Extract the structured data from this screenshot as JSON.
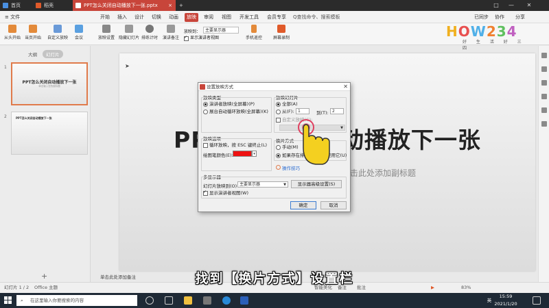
{
  "tabs": [
    {
      "label": "首页",
      "icon": "home-icon",
      "color": "#4a90e2"
    },
    {
      "label": "稻壳",
      "icon": "docer-icon",
      "color": "#e05a2a"
    },
    {
      "label": "PPT怎么关闭自动播放下一张.pptx",
      "icon": "pptx-file-icon",
      "color": "#e06a3a",
      "active": true
    }
  ],
  "window_controls": [
    "□",
    "—",
    "✕"
  ],
  "menu": {
    "file_label": "≡ 文件",
    "items": [
      "开始",
      "插入",
      "设计",
      "切换",
      "动画",
      "放映",
      "审阅",
      "视图",
      "开发工具",
      "会员专享"
    ],
    "active_item": "放映",
    "search_label": "Q查找命令、搜索模板",
    "right": [
      "已同步",
      "协作",
      "分享"
    ]
  },
  "ribbon": {
    "buttons": [
      "从头开始",
      "当页开始",
      "自定义放映",
      "会议",
      "放映设置",
      "隐藏幻灯片",
      "排练计时",
      "演讲备注",
      "手机遥控",
      "屏幕录制"
    ],
    "display_label": "放映到：",
    "display_value": "主要显示器",
    "presenter_view": "显示演讲者视图"
  },
  "logo": {
    "text": "HOW234",
    "slogan": "好 生 活 好 三 四"
  },
  "left_panel": {
    "tabs": [
      "大纲",
      "幻灯片"
    ],
    "active_tab": "幻灯片",
    "thumbnails": [
      {
        "num": "1",
        "title": "PPT怎么关闭自动播放下一张",
        "sub": "单击输入您的副标题"
      },
      {
        "num": "2",
        "title": "PPT怎么关闭自动播放下一张"
      }
    ]
  },
  "slide": {
    "title": "PPT怎么关闭自动播放下一张",
    "subtitle": "单击此处添加副标题"
  },
  "notes_placeholder": "单击此处添加备注",
  "status": {
    "slide_pos": "幻灯片 1 / 2",
    "theme": "Office 主题",
    "beautify": "智能美化",
    "notes": "备注",
    "comment": "批注",
    "zoom": "83%"
  },
  "caption": "找到【换片方式】设置栏",
  "dialog": {
    "title": "设置放映方式",
    "type_group": "放映类型",
    "type_options": [
      "演讲者放映(全屏幕)(P)",
      "展台自动循环放映(全屏幕)(K)"
    ],
    "slides_group": "放映幻灯片",
    "all_label": "全部(A)",
    "from_label": "从(F):",
    "from_value": "1",
    "to_label": "到(T):",
    "to_value": "2",
    "custom_label": "自定义放映(C):",
    "options_group": "放映选项",
    "loop_label": "循环放映，按 ESC 键终止(L)",
    "pen_label": "绘图笔颜色(E):",
    "pen_color": "#ee1111",
    "advance_group": "换片方式",
    "manual_label": "手动(M)",
    "timing_label": "如果存在排练时间，则使用它(U)",
    "tips_label": "操作技巧",
    "monitor_group": "多显示器",
    "monitor_label": "幻灯片放映到(O):",
    "monitor_value": "主要显示器",
    "resolution_button": "显示器高级设置(S)",
    "presenter_view_label": "显示演讲者视图(W)",
    "ok": "确定",
    "cancel": "取消"
  },
  "taskbar": {
    "search_placeholder": "在这里输入你要搜索的内容",
    "time": "15:59",
    "date": "2021/1/20",
    "lang": "英"
  },
  "colors": {
    "accent": "#c8453a",
    "taskbar": "#1f2a36"
  }
}
